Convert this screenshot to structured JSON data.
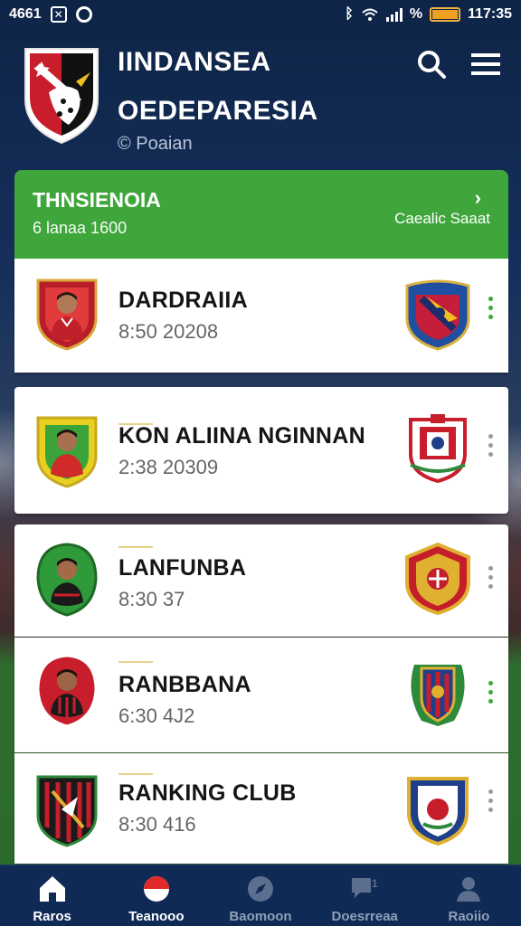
{
  "status_bar": {
    "left_text": "4661",
    "time": "117:35"
  },
  "header": {
    "title_line1": "IINDANSEA",
    "title_line2": "OEDEPARESIA",
    "subtitle": "© Poaian",
    "icons": [
      "search-icon",
      "menu-icon"
    ]
  },
  "featured": {
    "title": "THNSIENOIA",
    "subtitle": "6 lanaa 1600",
    "link_label": "Caealic Saaat",
    "chevron": "›",
    "color": "#3fa63b"
  },
  "players": [
    {
      "name": "DARDRAIIA",
      "meta": "8:50 20208",
      "dots_color": "#3fa63b"
    },
    {
      "name": "KON ALIINA NGINNAN",
      "meta": "2:38 20309",
      "dots_color": "#9a9a9a"
    },
    {
      "name": "LANFUNBA",
      "meta": "8:30 37",
      "dots_color": "#9a9a9a"
    },
    {
      "name": "RANBBANA",
      "meta": "6:30 4J2",
      "dots_color": "#3fa63b"
    },
    {
      "name": "RANKING CLUB",
      "meta": "8:30 416",
      "dots_color": "#9a9a9a"
    }
  ],
  "bottom_nav": [
    {
      "label": "Raros",
      "icon": "home-icon",
      "active": true
    },
    {
      "label": "Teanooo",
      "icon": "ball-icon",
      "active": true
    },
    {
      "label": "Baomoon",
      "icon": "compass-icon",
      "active": false
    },
    {
      "label": "Doesrreaa",
      "icon": "chat-icon",
      "active": false
    },
    {
      "label": "Raoiio",
      "icon": "profile-icon",
      "active": false
    }
  ]
}
